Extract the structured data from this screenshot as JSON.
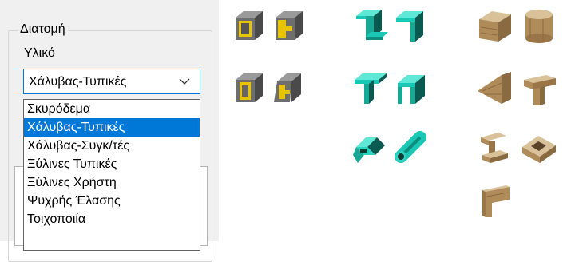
{
  "section": {
    "title": "Διατομή"
  },
  "material": {
    "label": "Υλικό",
    "selected": "Χάλυβας-Τυπικές",
    "options": [
      "Σκυρόδεμα",
      "Χάλυβας-Τυπικές",
      "Χάλυβας-Συγκ/τές",
      "Ξύλινες Τυπικές",
      "Ξύλινες Χρήστη",
      "Ψυχρής Έλασης",
      "Τοιχοποιία"
    ]
  },
  "colors": {
    "accent": "#0078d7",
    "steel_teal": "#18c8b4",
    "wood": "#c4a77e",
    "composite_gray": "#6e6e6e",
    "composite_yellow": "#e8c300"
  },
  "profiles": {
    "composite": [
      "composite-box-section-icon",
      "composite-channel-section-icon",
      "composite-box-section-variant-icon",
      "composite-channel-section-variant-icon"
    ],
    "steel": [
      "steel-z-section-icon",
      "steel-angle-section-icon",
      "steel-t-section-icon",
      "steel-channel-section-icon",
      "steel-square-hollow-section-icon",
      "steel-circular-hollow-section-icon"
    ],
    "timber": [
      "timber-rectangular-section-icon",
      "timber-circular-section-icon",
      "timber-triangular-section-icon",
      "timber-t-section-icon",
      "timber-i-section-icon",
      "timber-box-section-icon",
      "timber-angle-section-icon"
    ]
  }
}
